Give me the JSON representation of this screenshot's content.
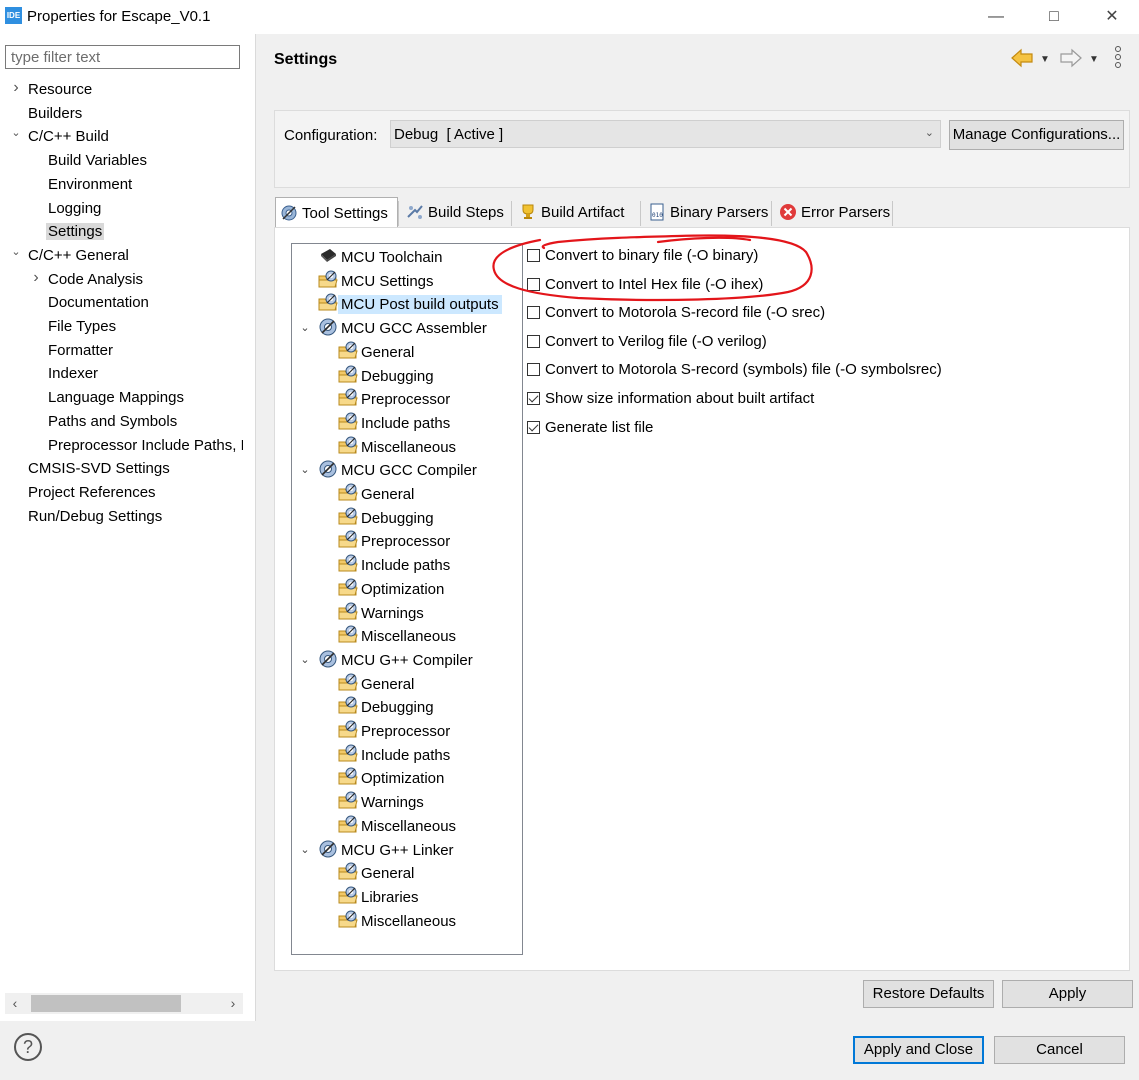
{
  "window": {
    "app_icon_text": "IDE",
    "title": "Properties for Escape_V0.1",
    "minimize_icon": "minimize-icon",
    "maximize_icon": "maximize-icon",
    "close_icon": "close-icon"
  },
  "filter": {
    "placeholder": "type filter text",
    "value": ""
  },
  "nav": {
    "items": [
      {
        "label": "Resource",
        "twisty": "collapsed"
      },
      {
        "label": "Builders"
      },
      {
        "label": "C/C++ Build",
        "twisty": "expanded"
      },
      {
        "label": "Build Variables"
      },
      {
        "label": "Environment"
      },
      {
        "label": "Logging"
      },
      {
        "label": "Settings",
        "selected": true
      },
      {
        "label": "C/C++ General",
        "twisty": "expanded"
      },
      {
        "label": "Code Analysis",
        "twisty": "collapsed"
      },
      {
        "label": "Documentation"
      },
      {
        "label": "File Types"
      },
      {
        "label": "Formatter"
      },
      {
        "label": "Indexer"
      },
      {
        "label": "Language Mappings"
      },
      {
        "label": "Paths and Symbols"
      },
      {
        "label": "Preprocessor Include Paths, M"
      },
      {
        "label": "CMSIS-SVD Settings"
      },
      {
        "label": "Project References"
      },
      {
        "label": "Run/Debug Settings"
      }
    ]
  },
  "settings": {
    "title": "Settings",
    "back_icon": "back-arrow-icon",
    "forward_icon": "forward-arrow-icon",
    "menu_icon": "view-menu-icon"
  },
  "config": {
    "label": "Configuration:",
    "selected": "Debug  [ Active ]",
    "manage_button": "Manage Configurations..."
  },
  "tabs": [
    {
      "label": "Tool Settings",
      "icon": "tool-settings-icon",
      "active": true
    },
    {
      "label": "Build Steps",
      "icon": "build-steps-icon"
    },
    {
      "label": "Build Artifact",
      "icon": "build-artifact-icon"
    },
    {
      "label": "Binary Parsers",
      "icon": "binary-parsers-icon"
    },
    {
      "label": "Error Parsers",
      "icon": "error-parsers-icon"
    }
  ],
  "tool_tree": {
    "items": [
      {
        "label": "MCU Toolchain",
        "icon": "chip-icon"
      },
      {
        "label": "MCU Settings",
        "icon": "folder-gear-icon"
      },
      {
        "label": "MCU Post build outputs",
        "icon": "folder-gear-icon",
        "selected": true
      },
      {
        "label": "MCU GCC Assembler",
        "icon": "gear-icon",
        "twisty": "expanded"
      },
      {
        "label": "General",
        "icon": "folder-gear-icon"
      },
      {
        "label": "Debugging",
        "icon": "folder-gear-icon"
      },
      {
        "label": "Preprocessor",
        "icon": "folder-gear-icon"
      },
      {
        "label": "Include paths",
        "icon": "folder-gear-icon"
      },
      {
        "label": "Miscellaneous",
        "icon": "folder-gear-icon"
      },
      {
        "label": "MCU GCC Compiler",
        "icon": "gear-icon",
        "twisty": "expanded"
      },
      {
        "label": "General",
        "icon": "folder-gear-icon"
      },
      {
        "label": "Debugging",
        "icon": "folder-gear-icon"
      },
      {
        "label": "Preprocessor",
        "icon": "folder-gear-icon"
      },
      {
        "label": "Include paths",
        "icon": "folder-gear-icon"
      },
      {
        "label": "Optimization",
        "icon": "folder-gear-icon"
      },
      {
        "label": "Warnings",
        "icon": "folder-gear-icon"
      },
      {
        "label": "Miscellaneous",
        "icon": "folder-gear-icon"
      },
      {
        "label": "MCU G++ Compiler",
        "icon": "gear-icon",
        "twisty": "expanded"
      },
      {
        "label": "General",
        "icon": "folder-gear-icon"
      },
      {
        "label": "Debugging",
        "icon": "folder-gear-icon"
      },
      {
        "label": "Preprocessor",
        "icon": "folder-gear-icon"
      },
      {
        "label": "Include paths",
        "icon": "folder-gear-icon"
      },
      {
        "label": "Optimization",
        "icon": "folder-gear-icon"
      },
      {
        "label": "Warnings",
        "icon": "folder-gear-icon"
      },
      {
        "label": "Miscellaneous",
        "icon": "folder-gear-icon"
      },
      {
        "label": "MCU G++ Linker",
        "icon": "gear-icon",
        "twisty": "expanded"
      },
      {
        "label": "General",
        "icon": "folder-gear-icon"
      },
      {
        "label": "Libraries",
        "icon": "folder-gear-icon"
      },
      {
        "label": "Miscellaneous",
        "icon": "folder-gear-icon"
      }
    ]
  },
  "options": [
    {
      "label": "Convert to binary file (-O binary)",
      "checked": false
    },
    {
      "label": "Convert to Intel Hex file (-O ihex)",
      "checked": false
    },
    {
      "label": "Convert to Motorola S-record file (-O srec)",
      "checked": false
    },
    {
      "label": "Convert to Verilog file (-O verilog)",
      "checked": false
    },
    {
      "label": "Convert to Motorola S-record (symbols) file (-O symbolsrec)",
      "checked": false
    },
    {
      "label": "Show size information about built artifact",
      "checked": true
    },
    {
      "label": "Generate list file",
      "checked": true
    }
  ],
  "annotation": {
    "color": "#e3151a"
  },
  "buttons": {
    "restore_defaults": "Restore Defaults",
    "apply": "Apply",
    "apply_and_close": "Apply and Close",
    "cancel": "Cancel",
    "help_icon": "help-icon"
  },
  "colors": {
    "accent": "#0078d7",
    "selection": "#cce8ff"
  }
}
